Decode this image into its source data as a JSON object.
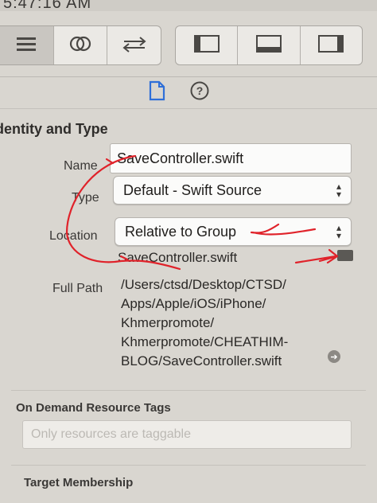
{
  "status_bar": {
    "time_fragment": "5:47:16 AM"
  },
  "toolbar": {
    "left_icons": [
      "hamburger-lines-icon",
      "venn-circles-icon",
      "swap-arrows-icon"
    ],
    "right_icons": [
      "left-panel-icon",
      "bottom-panel-icon",
      "right-panel-icon"
    ]
  },
  "inspector_tabs": [
    "file-inspector-icon",
    "quick-help-icon"
  ],
  "identity": {
    "title": "dentity and Type",
    "name_label": "Name",
    "name_value": "SaveController.swift",
    "type_label": "Type",
    "type_value": "Default - Swift Source",
    "location_label": "Location",
    "location_value": "Relative to Group",
    "filename": "SaveController.swift",
    "full_path_label": "Full Path",
    "full_path_lines": [
      "/Users/ctsd/Desktop/CTSD/",
      "Apps/Apple/iOS/iPhone/",
      "Khmerpromote/",
      "Khmerpromote/CHEATHIM-",
      "BLOG/SaveController.swift"
    ]
  },
  "on_demand": {
    "title": "On Demand Resource Tags",
    "placeholder": "Only resources are taggable"
  },
  "target_membership": {
    "title": "Target Membership"
  },
  "annotation_color": "#e0222a"
}
